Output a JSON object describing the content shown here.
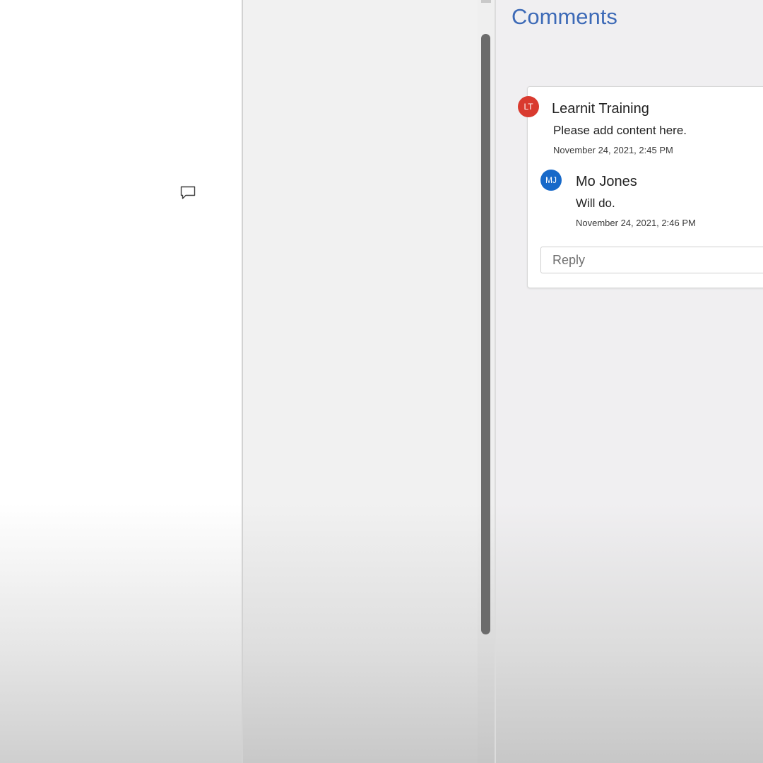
{
  "comments_pane": {
    "title": "Comments",
    "thread": {
      "comment": {
        "avatar_initials": "LT",
        "avatar_color": "#d93a2f",
        "author": "Learnit Training",
        "text": "Please add content here.",
        "timestamp": "November 24, 2021, 2:45 PM"
      },
      "replies": [
        {
          "avatar_initials": "MJ",
          "avatar_color": "#1769c9",
          "author": "Mo Jones",
          "text": "Will do.",
          "timestamp": "November 24, 2021, 2:46 PM"
        }
      ],
      "reply_input": {
        "placeholder": "Reply",
        "value": ""
      }
    }
  },
  "document": {
    "comment_marker_icon": "speech-bubble-icon"
  },
  "colors": {
    "pane_title": "#3d6ab7",
    "scroll_thumb": "#6b6b6b"
  }
}
